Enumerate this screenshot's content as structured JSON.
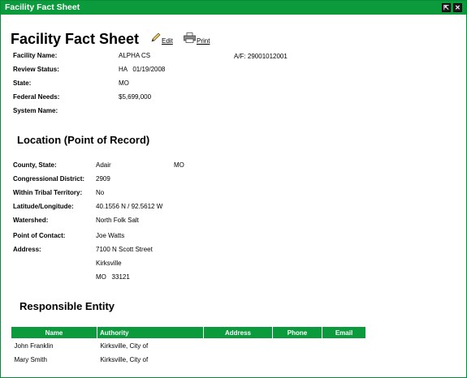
{
  "window": {
    "title": "Facility Fact Sheet",
    "pin_glyph": "⇱",
    "close_glyph": "✕"
  },
  "header": {
    "title": "Facility Fact Sheet",
    "edit_label": "Edit",
    "print_label": "Print"
  },
  "facility": {
    "name_label": "Facility Name:",
    "name_value": "ALPHA CS",
    "af_value": "A/F: 29001012001",
    "review_label": "Review Status:",
    "review_value": "HA   01/19/2008",
    "state_label": "State:",
    "state_value": "MO",
    "needs_label": "Federal Needs:",
    "needs_value": "$5,699,000",
    "system_label": "System Name:",
    "system_value": ""
  },
  "location": {
    "title": "Location (Point of Record)",
    "county_label": "County, State:",
    "county_value": "Adair",
    "county_state": "MO",
    "district_label": "Congressional District:",
    "district_value": "2909",
    "tribal_label": "Within Tribal Territory:",
    "tribal_value": "No",
    "latlon_label": "Latitude/Longitude:",
    "latlon_value": "40.1556 N / 92.5612 W",
    "watershed_label": "Watershed:",
    "watershed_value": "North Folk Salt",
    "contact_label": "Point of Contact:",
    "contact_value": "Joe Watts",
    "address_label": "Address:",
    "address_line1": "7100 N Scott Street",
    "address_line2": "Kirksville",
    "address_line3": "MO   33121"
  },
  "entity": {
    "title": "Responsible Entity",
    "columns": [
      "Name",
      "Authority",
      "Address",
      "Phone",
      "Email"
    ],
    "rows": [
      {
        "name": "John Franklin",
        "authority": "Kirksville, City of",
        "address": "",
        "phone": "",
        "email": ""
      },
      {
        "name": "Mary Smith",
        "authority": "Kirksville, City of",
        "address": "",
        "phone": "",
        "email": ""
      }
    ]
  },
  "colors": {
    "accent_green": "#0b9a3c"
  }
}
